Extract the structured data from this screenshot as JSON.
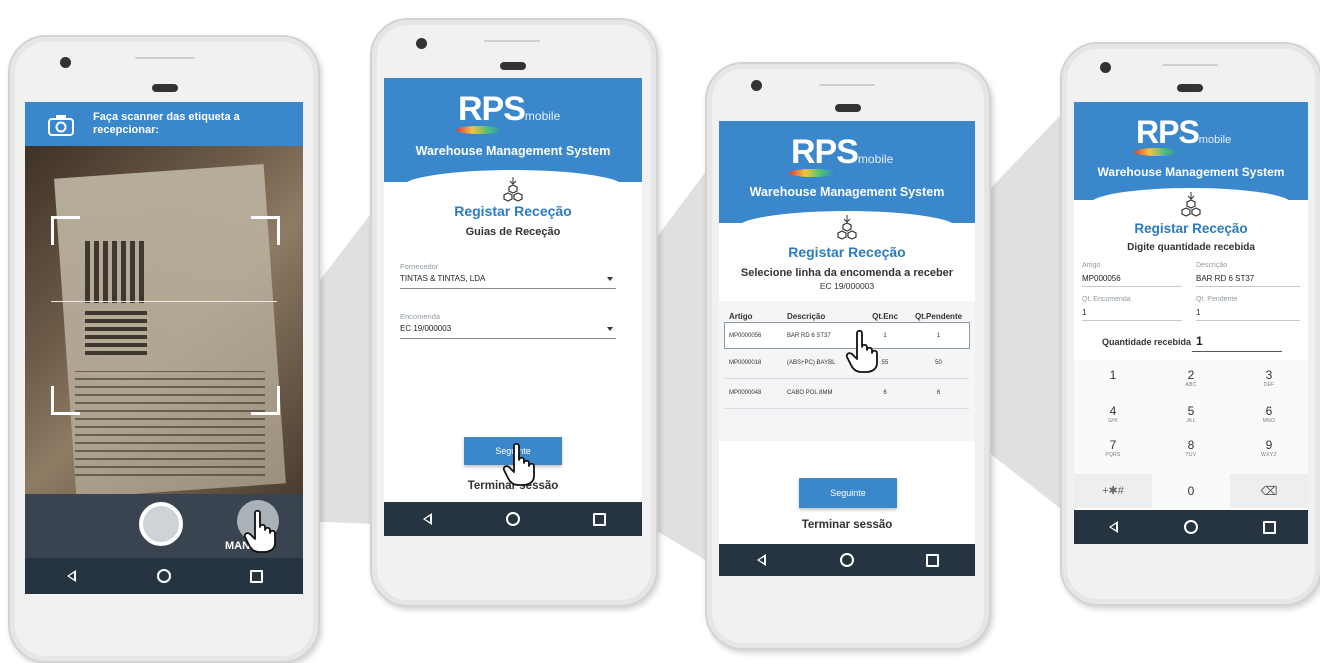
{
  "scanner": {
    "prompt": "Faça scanner das etiqueta a recepcionar:",
    "manual_label": "MANUAL"
  },
  "brand": {
    "logo_main": "RPS",
    "logo_sub": "mobile",
    "subtitle": "Warehouse Management System",
    "accent": "#3a87cc",
    "nav_color": "#263442"
  },
  "screen_guides": {
    "title": "Registar Receção",
    "heading": "Guias de Receção",
    "fornecedor_label": "Fornecedor",
    "fornecedor_value": "TINTAS & TINTAS, LDA",
    "encomenda_label": "Encomenda",
    "encomenda_value": "EC 19/000003",
    "next_button": "Seguinte",
    "logout": "Terminar sessão"
  },
  "screen_lines": {
    "title": "Registar Receção",
    "heading": "Selecione linha da encomenda a receber",
    "order": "EC 19/000003",
    "columns": [
      "Artigo",
      "Descrição",
      "Qt.Enc",
      "Qt.Pendente"
    ],
    "rows": [
      [
        "MP0000056",
        "BAR RD 6 ST37",
        "1",
        "1"
      ],
      [
        "MP0000018",
        "(ABS+PC) BAYBL",
        "55",
        "50"
      ],
      [
        "MP0000048",
        "CABO POL 8MM",
        "6",
        "6"
      ]
    ],
    "next_button": "Seguinte",
    "logout": "Terminar sessão"
  },
  "screen_qty": {
    "title": "Registar Receção",
    "heading": "Digite quantidade recebida",
    "artigo_label": "Artigo",
    "artigo_value": "MP000056",
    "descricao_label": "Descrição",
    "descricao_value": "BAR RD 6 ST37",
    "qt_enc_label": "Qt. Encomenda",
    "qt_enc_value": "1",
    "qt_pend_label": "Qt. Pendente",
    "qt_pend_value": "1",
    "qty_label": "Quantidade recebida",
    "qty_value": "1",
    "keys": [
      {
        "d": "1",
        "l": ""
      },
      {
        "d": "2",
        "l": "ABC"
      },
      {
        "d": "3",
        "l": "DEF"
      },
      {
        "d": "4",
        "l": "GHI"
      },
      {
        "d": "5",
        "l": "JKL"
      },
      {
        "d": "6",
        "l": "MNO"
      },
      {
        "d": "7",
        "l": "PQRS"
      },
      {
        "d": "8",
        "l": "TUV"
      },
      {
        "d": "9",
        "l": "WXYZ"
      },
      {
        "d": "+✱#",
        "l": ""
      },
      {
        "d": "0",
        "l": ""
      },
      {
        "d": "⌫",
        "l": ""
      }
    ]
  }
}
